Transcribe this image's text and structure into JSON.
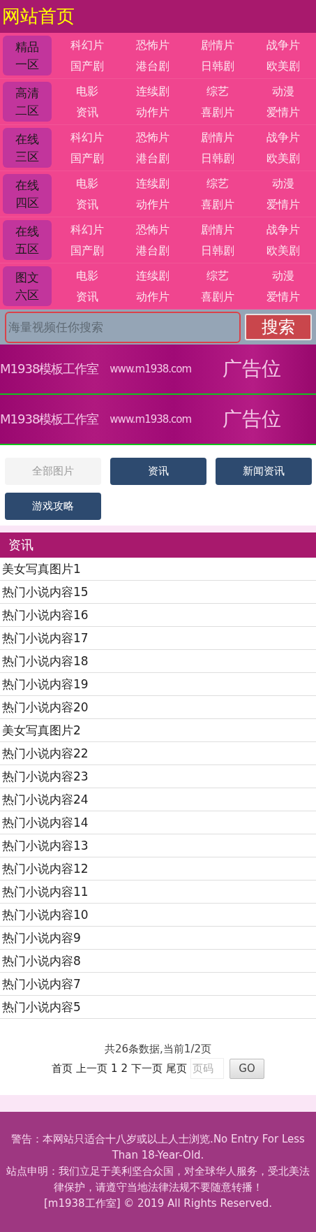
{
  "header": {
    "title": "网站首页"
  },
  "zones": [
    {
      "label": "精品一区",
      "links": [
        "科幻片",
        "恐怖片",
        "剧情片",
        "战争片",
        "国产剧",
        "港台剧",
        "日韩剧",
        "欧美剧"
      ]
    },
    {
      "label": "高清二区",
      "links": [
        "电影",
        "连续剧",
        "综艺",
        "动漫",
        "资讯",
        "动作片",
        "喜剧片",
        "爱情片"
      ]
    },
    {
      "label": "在线三区",
      "links": [
        "科幻片",
        "恐怖片",
        "剧情片",
        "战争片",
        "国产剧",
        "港台剧",
        "日韩剧",
        "欧美剧"
      ]
    },
    {
      "label": "在线四区",
      "links": [
        "电影",
        "连续剧",
        "综艺",
        "动漫",
        "资讯",
        "动作片",
        "喜剧片",
        "爱情片"
      ]
    },
    {
      "label": "在线五区",
      "links": [
        "科幻片",
        "恐怖片",
        "剧情片",
        "战争片",
        "国产剧",
        "港台剧",
        "日韩剧",
        "欧美剧"
      ]
    },
    {
      "label": "图文六区",
      "links": [
        "电影",
        "连续剧",
        "综艺",
        "动漫",
        "资讯",
        "动作片",
        "喜剧片",
        "爱情片"
      ]
    }
  ],
  "search": {
    "placeholder": "海量视频任你搜索",
    "button": "搜索"
  },
  "ads": [
    {
      "brand": "M1938模板工作室",
      "url": "www.m1938.com",
      "slot": "广告位"
    },
    {
      "brand": "M1938模板工作室",
      "url": "www.m1938.com",
      "slot": "广告位"
    }
  ],
  "tabs": [
    {
      "label": "全部图片",
      "selected": true
    },
    {
      "label": "资讯",
      "selected": false
    },
    {
      "label": "新闻资讯",
      "selected": false
    },
    {
      "label": "游戏攻略",
      "selected": false
    }
  ],
  "section": {
    "title": "资讯",
    "items": [
      "美女写真图片1",
      "热门小说内容15",
      "热门小说内容16",
      "热门小说内容17",
      "热门小说内容18",
      "热门小说内容19",
      "热门小说内容20",
      "美女写真图片2",
      "热门小说内容22",
      "热门小说内容23",
      "热门小说内容24",
      "热门小说内容14",
      "热门小说内容13",
      "热门小说内容12",
      "热门小说内容11",
      "热门小说内容10",
      "热门小说内容9",
      "热门小说内容8",
      "热门小说内容7",
      "热门小说内容5"
    ]
  },
  "pagination": {
    "summary": "共26条数据,当前1/2页",
    "links": [
      "首页",
      "上一页",
      "1",
      "2",
      "下一页",
      "尾页"
    ],
    "page_placeholder": "页码",
    "go": "GO"
  },
  "footer": {
    "lines": [
      "警告：本网站只适合十八岁或以上人士浏览.No Entry For Less Than 18-Year-Old.",
      "站点申明：我们立足于美利坚合众国，对全球华人服务，受北美法律保护，请遵守当地法律法规不要随意转播！",
      "[m1938工作室] © 2019 All Rights Reserved."
    ]
  }
}
